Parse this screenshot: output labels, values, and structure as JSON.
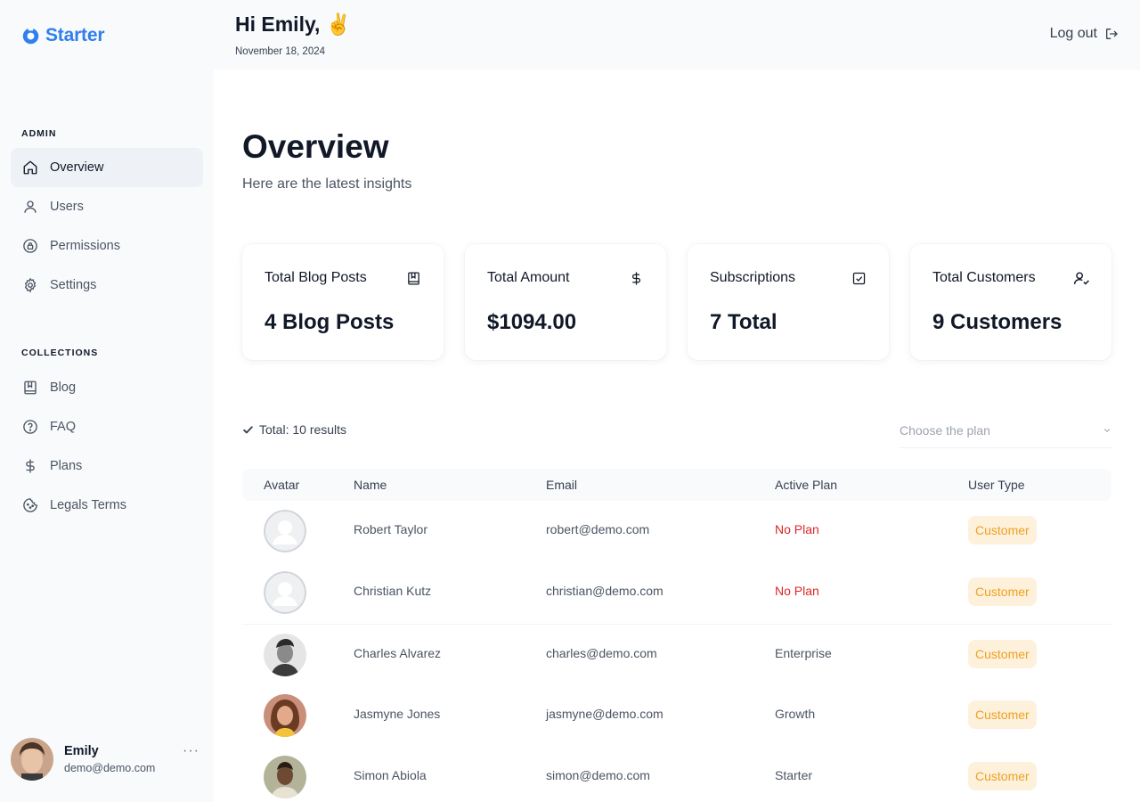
{
  "brand": {
    "name": "Starter",
    "color": "#2f80ed"
  },
  "sidebar": {
    "admin_label": "ADMIN",
    "admin_items": [
      {
        "label": "Overview",
        "icon": "home-icon",
        "active": true
      },
      {
        "label": "Users",
        "icon": "user-icon"
      },
      {
        "label": "Permissions",
        "icon": "lock-icon"
      },
      {
        "label": "Settings",
        "icon": "gear-icon"
      }
    ],
    "collections_label": "COLLECTIONS",
    "collection_items": [
      {
        "label": "Blog",
        "icon": "book-icon"
      },
      {
        "label": "FAQ",
        "icon": "help-circle-icon"
      },
      {
        "label": "Plans",
        "icon": "dollar-icon"
      },
      {
        "label": "Legals Terms",
        "icon": "cookie-icon"
      }
    ],
    "profile": {
      "name": "Emily",
      "email": "demo@demo.com",
      "more": "···"
    }
  },
  "header": {
    "greeting": "Hi Emily, ✌️",
    "date": "November 18, 2024",
    "logout_label": "Log out"
  },
  "main": {
    "title": "Overview",
    "subtitle": "Here are the latest insights",
    "cards": [
      {
        "title": "Total Blog Posts",
        "value": "4 Blog Posts",
        "icon": "book-icon"
      },
      {
        "title": "Total Amount",
        "value": "$1094.00",
        "icon": "dollar-icon"
      },
      {
        "title": "Subscriptions",
        "value": "7 Total",
        "icon": "check-square-icon"
      },
      {
        "title": "Total Customers",
        "value": "9 Customers",
        "icon": "user-check-icon"
      }
    ],
    "results_text": "Total: 10 results",
    "plan_select_placeholder": "Choose the plan"
  },
  "table": {
    "columns": [
      "Avatar",
      "Name",
      "Email",
      "Active Plan",
      "User Type"
    ],
    "rows": [
      {
        "name": "Robert Taylor",
        "email": "robert@demo.com",
        "plan": "No Plan",
        "type": "Customer",
        "avatar": "placeholder"
      },
      {
        "name": "Christian Kutz",
        "email": "christian@demo.com",
        "plan": "No Plan",
        "type": "Customer",
        "avatar": "placeholder"
      },
      {
        "name": "Charles Alvarez",
        "email": "charles@demo.com",
        "plan": "Enterprise",
        "type": "Customer",
        "avatar": "photo"
      },
      {
        "name": "Jasmyne Jones",
        "email": "jasmyne@demo.com",
        "plan": "Growth",
        "type": "Customer",
        "avatar": "photo"
      },
      {
        "name": "Simon Abiola",
        "email": "simon@demo.com",
        "plan": "Starter",
        "type": "Customer",
        "avatar": "photo"
      }
    ]
  },
  "colors": {
    "no_plan": "#dc2626",
    "badge_bg": "#fdf1dc",
    "badge_text": "#f0a020"
  }
}
